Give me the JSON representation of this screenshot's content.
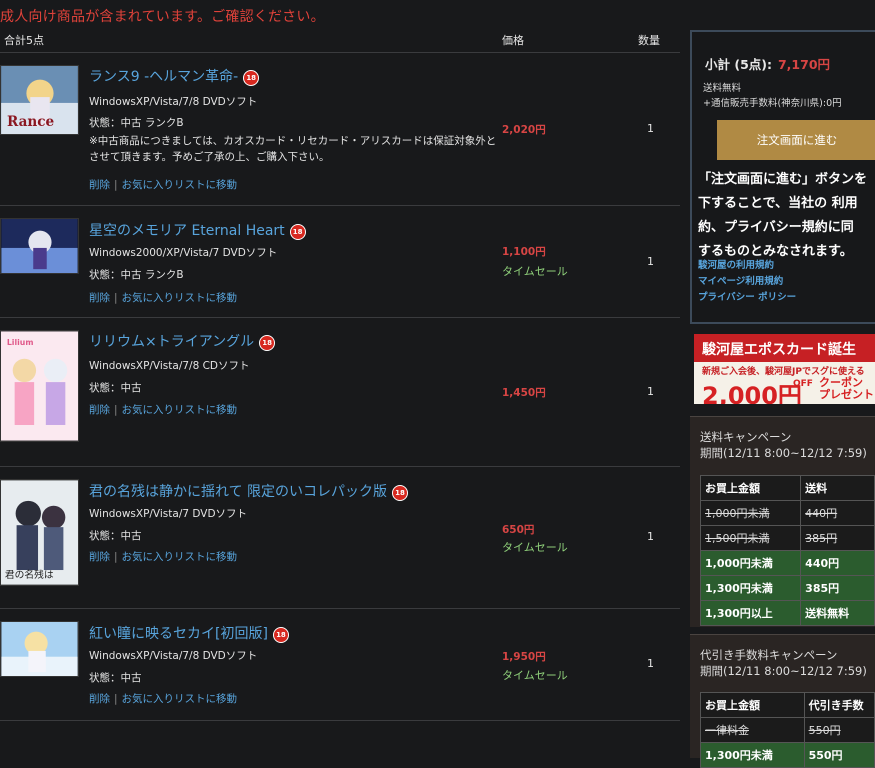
{
  "notice": "成人向け商品が含まれています。ご確認ください。",
  "header": {
    "total_label": "合計5点",
    "price_col": "価格",
    "qty_col": "数量"
  },
  "rating_badge": "18",
  "items": [
    {
      "title": "ランス9 -ヘルマン革命-",
      "platform": "WindowsXP/Vista/7/8  DVDソフト",
      "condition": "状態：中古 ランクB",
      "note": "※中古商品につきましては、カオスカード・リセカード・アリスカードは保証対象外とさせて頂きます。予めご了承の上、ご購入下さい。",
      "price": "2,020円",
      "sale": "",
      "qty": "1",
      "delete": "削除",
      "move": "お気に入りリストに移動"
    },
    {
      "title": "星空のメモリア Eternal Heart",
      "platform": "Windows2000/XP/Vista/7  DVDソフト",
      "condition": "状態：中古 ランクB",
      "price": "1,100円",
      "sale": "タイムセール",
      "qty": "1",
      "delete": "削除",
      "move": "お気に入りリストに移動"
    },
    {
      "title": "リリウム×トライアングル",
      "platform": "WindowsXP/Vista/7/8  CDソフト",
      "condition": "状態：中古",
      "price": "1,450円",
      "sale": "",
      "qty": "1",
      "delete": "削除",
      "move": "お気に入りリストに移動"
    },
    {
      "title": "君の名残は静かに揺れて 限定のいコレパック版",
      "platform": "WindowsXP/Vista/7  DVDソフト",
      "condition": "状態：中古",
      "price": "650円",
      "sale": "タイムセール",
      "qty": "1",
      "delete": "削除",
      "move": "お気に入りリストに移動"
    },
    {
      "title": "紅い瞳に映るセカイ[初回版]",
      "platform": "WindowsXP/Vista/7/8  DVDソフト",
      "condition": "状態：中古",
      "price": "1,950円",
      "sale": "タイムセール",
      "qty": "1",
      "delete": "削除",
      "move": "お気に入りリストに移動"
    }
  ],
  "summary": {
    "subtotal_label": "小計 (5点):",
    "subtotal_value": "7,170円",
    "shipping": "送料無料",
    "shipping_fee": "+通信販売手数料(神奈川県):0円",
    "order_button": "注文画面に進む",
    "agree_lines": [
      "「注文画面に進む」ボタンを",
      "下することで、当社の 利用",
      "約、プライバシー規約に同",
      "するものとみなされます。"
    ],
    "links": [
      "駿河屋の利用規約",
      "マイページ利用規約",
      "プライバシー ポリシー"
    ]
  },
  "banner": {
    "title": "駿河屋エポスカード誕生",
    "sub": "新規ご入会後、駿河屋JPでスグに使える",
    "amount": "2,000円",
    "off": "OFF",
    "coupon": "クーポン",
    "present": "プレゼント"
  },
  "shipping_campaign": {
    "title": "送料キャンペーン",
    "period": "期間(12/11 8:00~12/12 7:59)",
    "headers": [
      "お買上金額",
      "送料"
    ],
    "rows": [
      {
        "range": "1,000円未満",
        "fee": "440円",
        "style": "strike"
      },
      {
        "range": "1,500円未満",
        "fee": "385円",
        "style": "strike"
      },
      {
        "range": "1,000円未満",
        "fee": "440円",
        "style": "grn"
      },
      {
        "range": "1,300円未満",
        "fee": "385円",
        "style": "grn"
      },
      {
        "range": "1,300円以上",
        "fee": "送料無料",
        "style": "grn"
      }
    ]
  },
  "cod_campaign": {
    "title": "代引き手数料キャンペーン",
    "period": "期間(12/11 8:00~12/12 7:59)",
    "headers": [
      "お買上金額",
      "代引き手数"
    ],
    "rows": [
      {
        "range": "一律料金",
        "fee": "550円",
        "style": "strike"
      },
      {
        "range": "1,300円未満",
        "fee": "550円",
        "style": "grn"
      }
    ]
  }
}
